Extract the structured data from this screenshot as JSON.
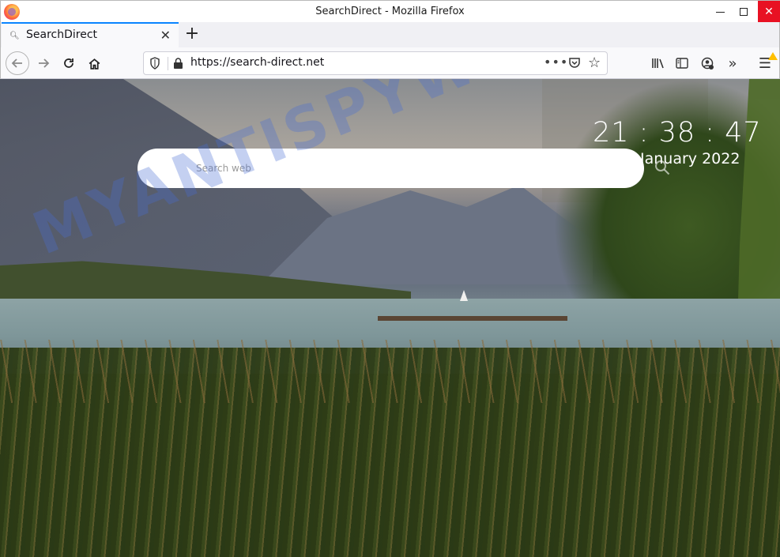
{
  "window": {
    "title": "SearchDirect - Mozilla Firefox",
    "close_color": "#e81123"
  },
  "tabs": [
    {
      "label": "SearchDirect",
      "favicon": "search-icon",
      "active": true
    }
  ],
  "newtab_label": "+",
  "urlbar": {
    "url": "https://search-direct.net",
    "more_label": "•••"
  },
  "page": {
    "clock": "21 : 38 : 47",
    "date": "January 2022",
    "search": {
      "placeholder": "Search web"
    },
    "watermark": "MYANTISPYWARE.COM"
  },
  "colors": {
    "tab_accent": "#0a84ff",
    "warning_badge": "#ffbf00"
  }
}
